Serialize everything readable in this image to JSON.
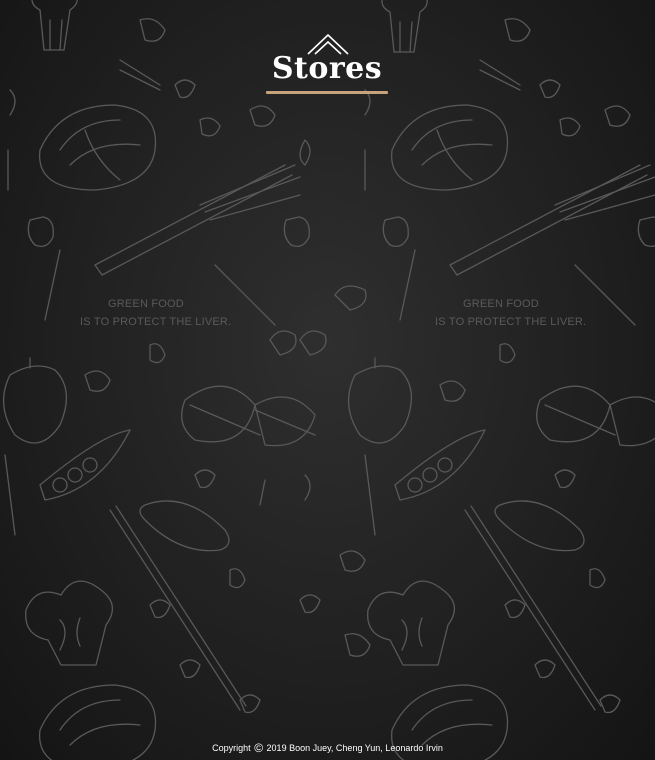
{
  "brand": {
    "name": "Stores",
    "accent_color": "#c8a27a",
    "icon": "house-roof-icon"
  },
  "background": {
    "pattern": "vegetables-line-art",
    "slogan_line1": "GREEN FOOD",
    "slogan_line2": "IS TO PROTECT THE LIVER."
  },
  "footer": {
    "copyright_prefix": "Copyright",
    "copyright_symbol": "©",
    "copyright_text": "2019 Boon Juey, Cheng Yun, Leonardo Irvin"
  }
}
